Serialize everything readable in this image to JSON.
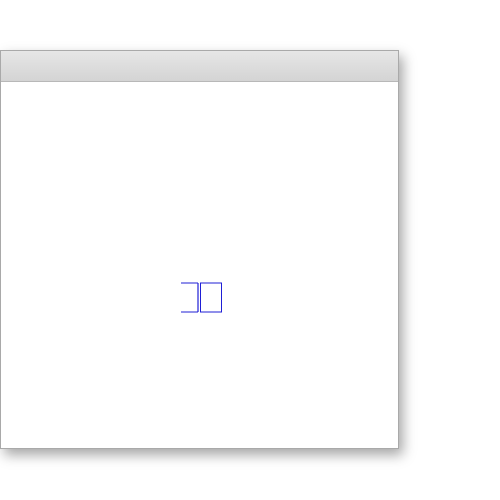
{
  "window": {
    "title": ""
  },
  "colors": {
    "titlebar": "#dcdcdc",
    "border": "#a9a9a9",
    "widget_stroke": "#1f1fd6",
    "widget_fill": "#ffffff"
  },
  "icons": {
    "widget": "split-box-icon"
  }
}
